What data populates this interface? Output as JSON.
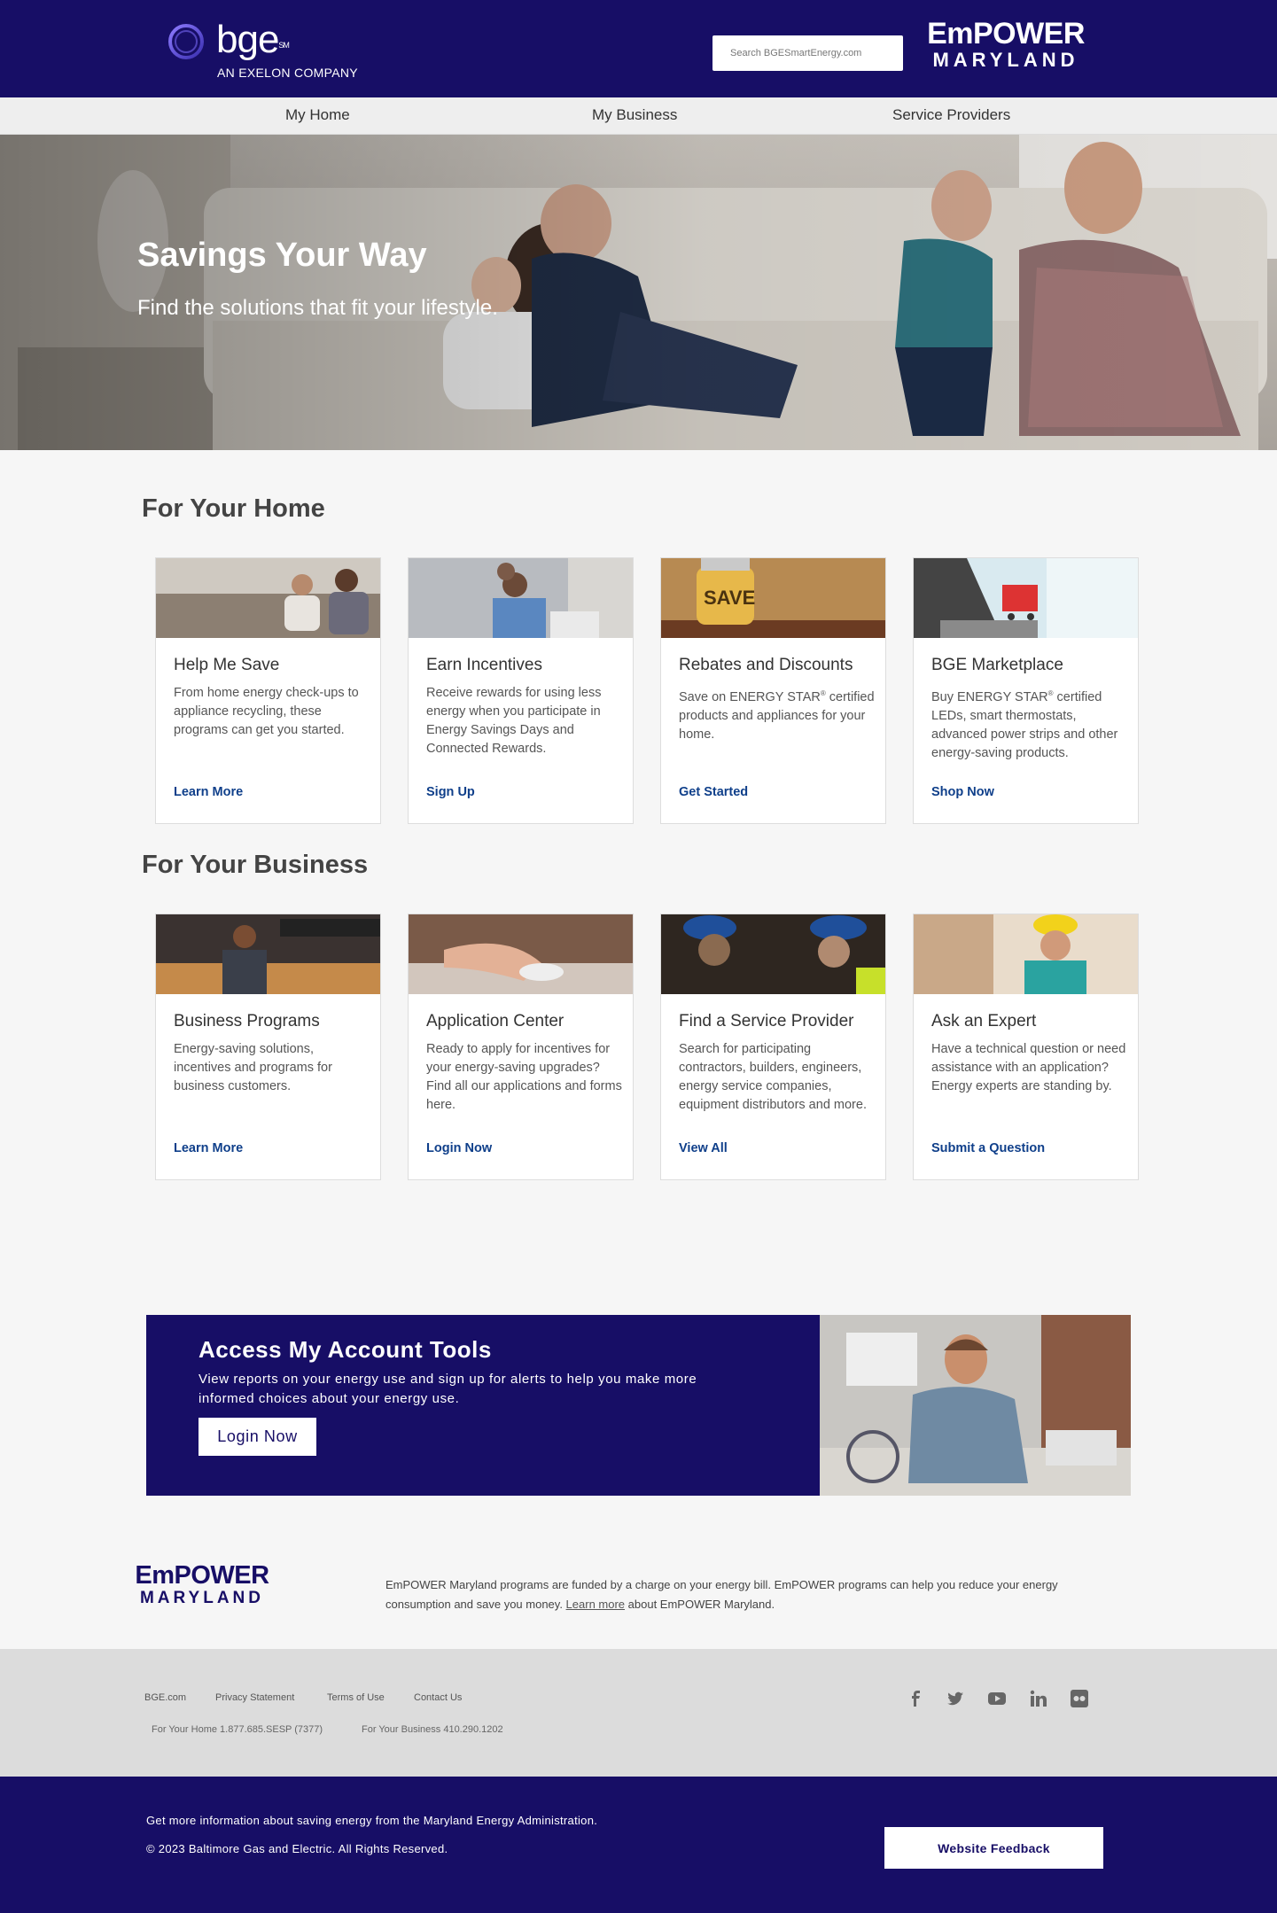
{
  "header": {
    "brand_word": "bge",
    "brand_mark": "SM",
    "brand_sub": "AN EXELON COMPANY",
    "search_placeholder": "Search BGESmartEnergy.com",
    "empower_top": "EmPOWER",
    "empower_bottom": "MARYLAND"
  },
  "nav": {
    "items": [
      {
        "label": "My Home"
      },
      {
        "label": "My Business"
      },
      {
        "label": "Service Providers"
      }
    ]
  },
  "hero": {
    "title": "Savings Your Way",
    "subtitle": "Find the solutions that fit your lifestyle."
  },
  "home_section": {
    "title": "For Your Home",
    "cards": [
      {
        "title": "Help Me Save",
        "desc": "From home energy check-ups to appliance recycling, these programs can get you started.",
        "link": "Learn More"
      },
      {
        "title": "Earn Incentives",
        "desc": "Receive rewards for using less energy when you participate in Energy Savings Days and Connected Rewards.",
        "link": "Sign Up"
      },
      {
        "title": "Rebates and Discounts",
        "desc_pre": "Save on ENERGY STAR",
        "desc_sup": "®",
        "desc_post": " certified products and appliances for your home.",
        "link": "Get Started"
      },
      {
        "title": "BGE Marketplace",
        "desc_pre": "Buy ENERGY STAR",
        "desc_sup": "®",
        "desc_post": " certified LEDs, smart thermostats, advanced power strips and other energy-saving products.",
        "link": "Shop Now"
      }
    ]
  },
  "business_section": {
    "title": "For Your Business",
    "cards": [
      {
        "title": "Business Programs",
        "desc": "Energy-saving solutions, incentives and programs for business customers.",
        "link": "Learn More"
      },
      {
        "title": "Application Center",
        "desc": "Ready to apply for incentives for your energy-saving upgrades? Find all our applications and forms here.",
        "link": "Login Now"
      },
      {
        "title": "Find a Service Provider",
        "desc": "Search for participating contractors, builders, engineers, energy service companies, equipment distributors and more.",
        "link": "View All"
      },
      {
        "title": "Ask an Expert",
        "desc": "Have a technical question or need assistance with an application? Energy experts are standing by.",
        "link": "Submit a Question"
      }
    ]
  },
  "account": {
    "title": "Access My Account Tools",
    "text": "View reports on your energy use and sign up for alerts to help you make more informed choices about your energy use.",
    "button": "Login Now"
  },
  "funding": {
    "logo_top": "EmPOWER",
    "logo_bottom": "MARYLAND",
    "text_pre": "EmPOWER Maryland programs are funded by a charge on your energy bill. EmPOWER programs can help you reduce your energy consumption and save you money. ",
    "link": "Learn more",
    "text_post": " about EmPOWER Maryland."
  },
  "footer": {
    "links": [
      "BGE.com",
      "Privacy Statement",
      "Terms of Use",
      "Contact Us"
    ],
    "phones": [
      "For Your Home 1.877.685.SESP (7377)",
      "For Your Business 410.290.1202"
    ],
    "social_icons": [
      "facebook-icon",
      "twitter-icon",
      "youtube-icon",
      "linkedin-icon",
      "flickr-icon"
    ],
    "info": "Get more information about saving energy from the Maryland Energy Administration.",
    "copyright": "© 2023 Baltimore Gas and Electric. All Rights Reserved.",
    "feedback_button": "Website Feedback"
  },
  "colors": {
    "brand_navy": "#170e66",
    "link_blue": "#0f3f8a",
    "footer_gray": "#dcdcdc",
    "page_bg": "#f6f6f6"
  }
}
